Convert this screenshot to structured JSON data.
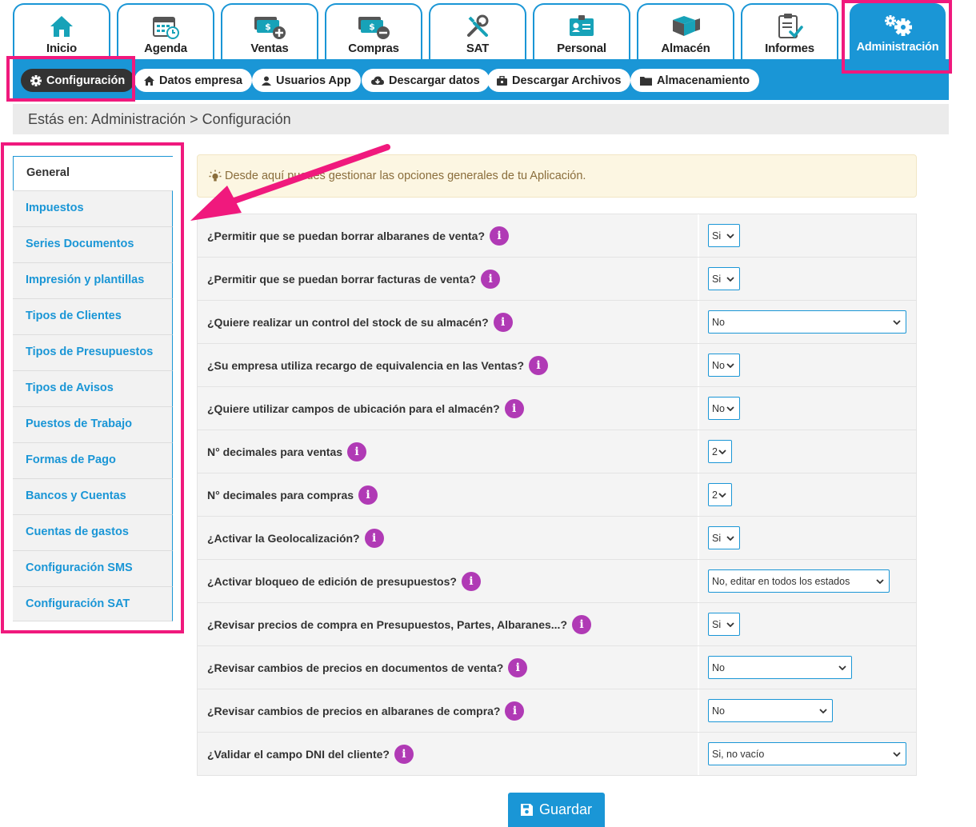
{
  "tabs": [
    {
      "label": "Inicio",
      "icon": "home-icon"
    },
    {
      "label": "Agenda",
      "icon": "calendar-icon"
    },
    {
      "label": "Ventas",
      "icon": "money-plus-icon"
    },
    {
      "label": "Compras",
      "icon": "money-minus-icon"
    },
    {
      "label": "SAT",
      "icon": "tools-icon"
    },
    {
      "label": "Personal",
      "icon": "id-card-icon"
    },
    {
      "label": "Almacén",
      "icon": "boxes-icon"
    },
    {
      "label": "Informes",
      "icon": "clipboard-check-icon"
    },
    {
      "label": "Administración",
      "icon": "gears-icon",
      "active": true
    }
  ],
  "subnav": [
    {
      "label": "Configuración",
      "icon": "gear-icon",
      "active": true
    },
    {
      "label": "Datos empresa",
      "icon": "home-icon"
    },
    {
      "label": "Usuarios App",
      "icon": "user-icon"
    },
    {
      "label": "Descargar datos",
      "icon": "cloud-download-icon"
    },
    {
      "label": "Descargar Archivos",
      "icon": "briefcase-icon"
    },
    {
      "label": "Almacenamiento",
      "icon": "folder-icon"
    }
  ],
  "breadcrumb": "Estás en: Administración > Configuración",
  "sidebar": {
    "items": [
      {
        "label": "General",
        "active": true
      },
      {
        "label": "Impuestos"
      },
      {
        "label": "Series Documentos"
      },
      {
        "label": "Impresión y plantillas"
      },
      {
        "label": "Tipos de Clientes"
      },
      {
        "label": "Tipos de Presupuestos"
      },
      {
        "label": "Tipos de Avisos"
      },
      {
        "label": "Puestos de Trabajo"
      },
      {
        "label": "Formas de Pago"
      },
      {
        "label": "Bancos y Cuentas"
      },
      {
        "label": "Cuentas de gastos"
      },
      {
        "label": "Configuración SMS"
      },
      {
        "label": "Configuración SAT"
      }
    ]
  },
  "alert": {
    "icon": "lightbulb-icon",
    "text": "Desde aquí puedes gestionar las opciones generales de tu Aplicación."
  },
  "settings": [
    {
      "question": "¿Permitir que se puedan borrar albaranes de venta?",
      "value": "Si"
    },
    {
      "question": "¿Permitir que se puedan borrar facturas de venta?",
      "value": "Si"
    },
    {
      "question": "¿Quiere realizar un control del stock de su almacén?",
      "value": "No"
    },
    {
      "question": "¿Su empresa utiliza recargo de equivalencia en las Ventas?",
      "value": "No"
    },
    {
      "question": "¿Quiere utilizar campos de ubicación para el almacén?",
      "value": "No"
    },
    {
      "question": "N° decimales para ventas",
      "value": "2"
    },
    {
      "question": "N° decimales para compras",
      "value": "2"
    },
    {
      "question": "¿Activar la Geolocalización?",
      "value": "Si"
    },
    {
      "question": "¿Activar bloqueo de edición de presupuestos?",
      "value": "No, editar en todos los estados"
    },
    {
      "question": "¿Revisar precios de compra en Presupuestos, Partes, Albaranes...?",
      "value": "Si"
    },
    {
      "question": "¿Revisar cambios de precios en documentos de venta?",
      "value": "No"
    },
    {
      "question": "¿Revisar cambios de precios en albaranes de compra?",
      "value": "No"
    },
    {
      "question": "¿Validar el campo DNI del cliente?",
      "value": "Si, no vacío"
    }
  ],
  "info_glyph": "i",
  "save_label": "Guardar",
  "colors": {
    "primary": "#1a96d6",
    "highlight": "#f0197d",
    "info": "#b03ab5",
    "alert_bg": "#fcf6e2"
  }
}
